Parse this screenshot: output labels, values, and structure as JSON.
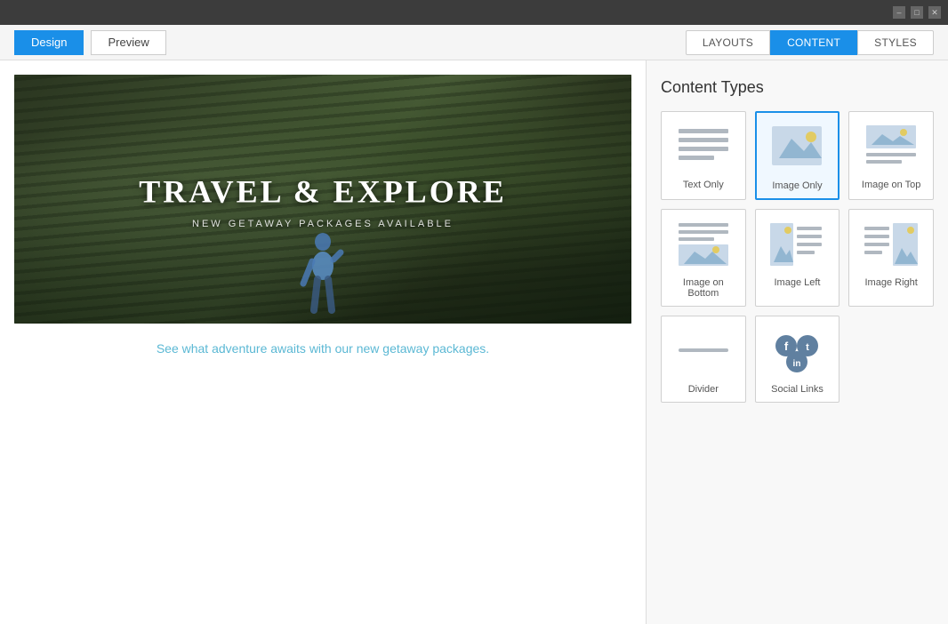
{
  "titleBar": {
    "controls": [
      "minimize",
      "maximize",
      "close"
    ]
  },
  "header": {
    "tabs": [
      {
        "id": "design",
        "label": "Design",
        "active": true
      },
      {
        "id": "preview",
        "label": "Preview",
        "active": false
      }
    ],
    "nav": [
      {
        "id": "layouts",
        "label": "LAYOUTS",
        "active": false
      },
      {
        "id": "content",
        "label": "CONTENT",
        "active": true
      },
      {
        "id": "styles",
        "label": "STYLES",
        "active": false
      }
    ]
  },
  "leftPanel": {
    "heroTitle": "TRAVEL & EXPLORE",
    "heroSubtitle": "NEW GETAWAY PACKAGES AVAILABLE",
    "descriptionText": "See what adventure awaits with our new getaway packages."
  },
  "rightPanel": {
    "sectionTitle": "Content Types",
    "contentTypes": [
      {
        "id": "text-only",
        "label": "Text Only",
        "selected": false,
        "disabled": false
      },
      {
        "id": "image-only",
        "label": "Image Only",
        "selected": true,
        "disabled": false
      },
      {
        "id": "image-on-top",
        "label": "Image on Top",
        "selected": false,
        "disabled": false
      },
      {
        "id": "image-on-bottom",
        "label": "Image on Bottom",
        "selected": false,
        "disabled": false
      },
      {
        "id": "image-left",
        "label": "Image Left",
        "selected": false,
        "disabled": false
      },
      {
        "id": "image-right",
        "label": "Image Right",
        "selected": false,
        "disabled": false
      },
      {
        "id": "divider",
        "label": "Divider",
        "selected": false,
        "disabled": false
      },
      {
        "id": "social-links",
        "label": "Social Links",
        "selected": false,
        "disabled": false
      }
    ]
  }
}
